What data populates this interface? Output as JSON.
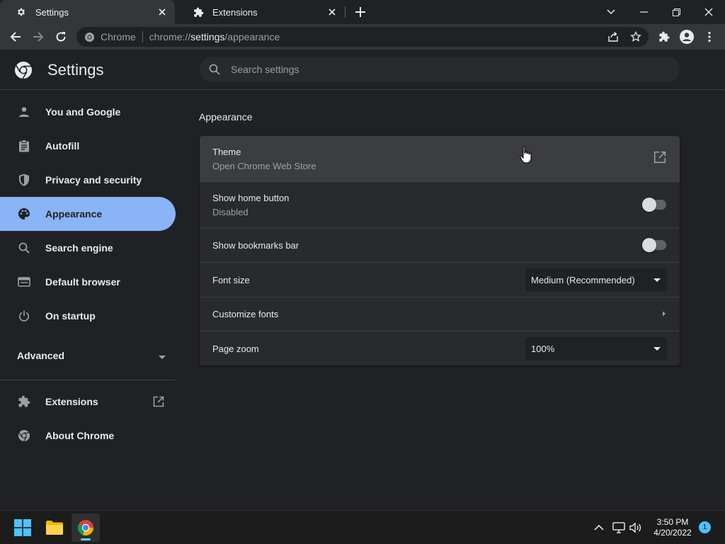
{
  "tabs": [
    {
      "title": "Settings",
      "icon": "gear-icon",
      "active": true
    },
    {
      "title": "Extensions",
      "icon": "puzzle-icon",
      "active": false
    }
  ],
  "omnibox": {
    "chip": "Chrome",
    "url_scheme": "chrome://",
    "url_host": "settings",
    "url_path": "/appearance"
  },
  "header": {
    "title": "Settings",
    "search_placeholder": "Search settings"
  },
  "sidebar": {
    "items": [
      {
        "label": "You and Google",
        "icon": "person-icon"
      },
      {
        "label": "Autofill",
        "icon": "clipboard-icon"
      },
      {
        "label": "Privacy and security",
        "icon": "shield-icon"
      },
      {
        "label": "Appearance",
        "icon": "palette-icon",
        "selected": true
      },
      {
        "label": "Search engine",
        "icon": "search-icon"
      },
      {
        "label": "Default browser",
        "icon": "browser-icon"
      },
      {
        "label": "On startup",
        "icon": "power-icon"
      }
    ],
    "advanced_label": "Advanced",
    "bottom_items": [
      {
        "label": "Extensions",
        "icon": "puzzle-icon"
      },
      {
        "label": "About Chrome",
        "icon": "chrome-icon"
      }
    ]
  },
  "appearance": {
    "section_title": "Appearance",
    "theme": {
      "label": "Theme",
      "sublabel": "Open Chrome Web Store"
    },
    "home_button": {
      "label": "Show home button",
      "sublabel": "Disabled",
      "enabled": false
    },
    "bookmarks_bar": {
      "label": "Show bookmarks bar",
      "enabled": false
    },
    "font_size": {
      "label": "Font size",
      "value": "Medium (Recommended)"
    },
    "customize_fonts": {
      "label": "Customize fonts"
    },
    "page_zoom": {
      "label": "Page zoom",
      "value": "100%"
    }
  },
  "taskbar": {
    "time": "3:50 PM",
    "date": "4/20/2022",
    "notification_count": "1"
  },
  "colors": {
    "background": "#202124",
    "card": "#292a2d",
    "accent": "#8ab4f8",
    "text_secondary": "#9aa0a6"
  }
}
